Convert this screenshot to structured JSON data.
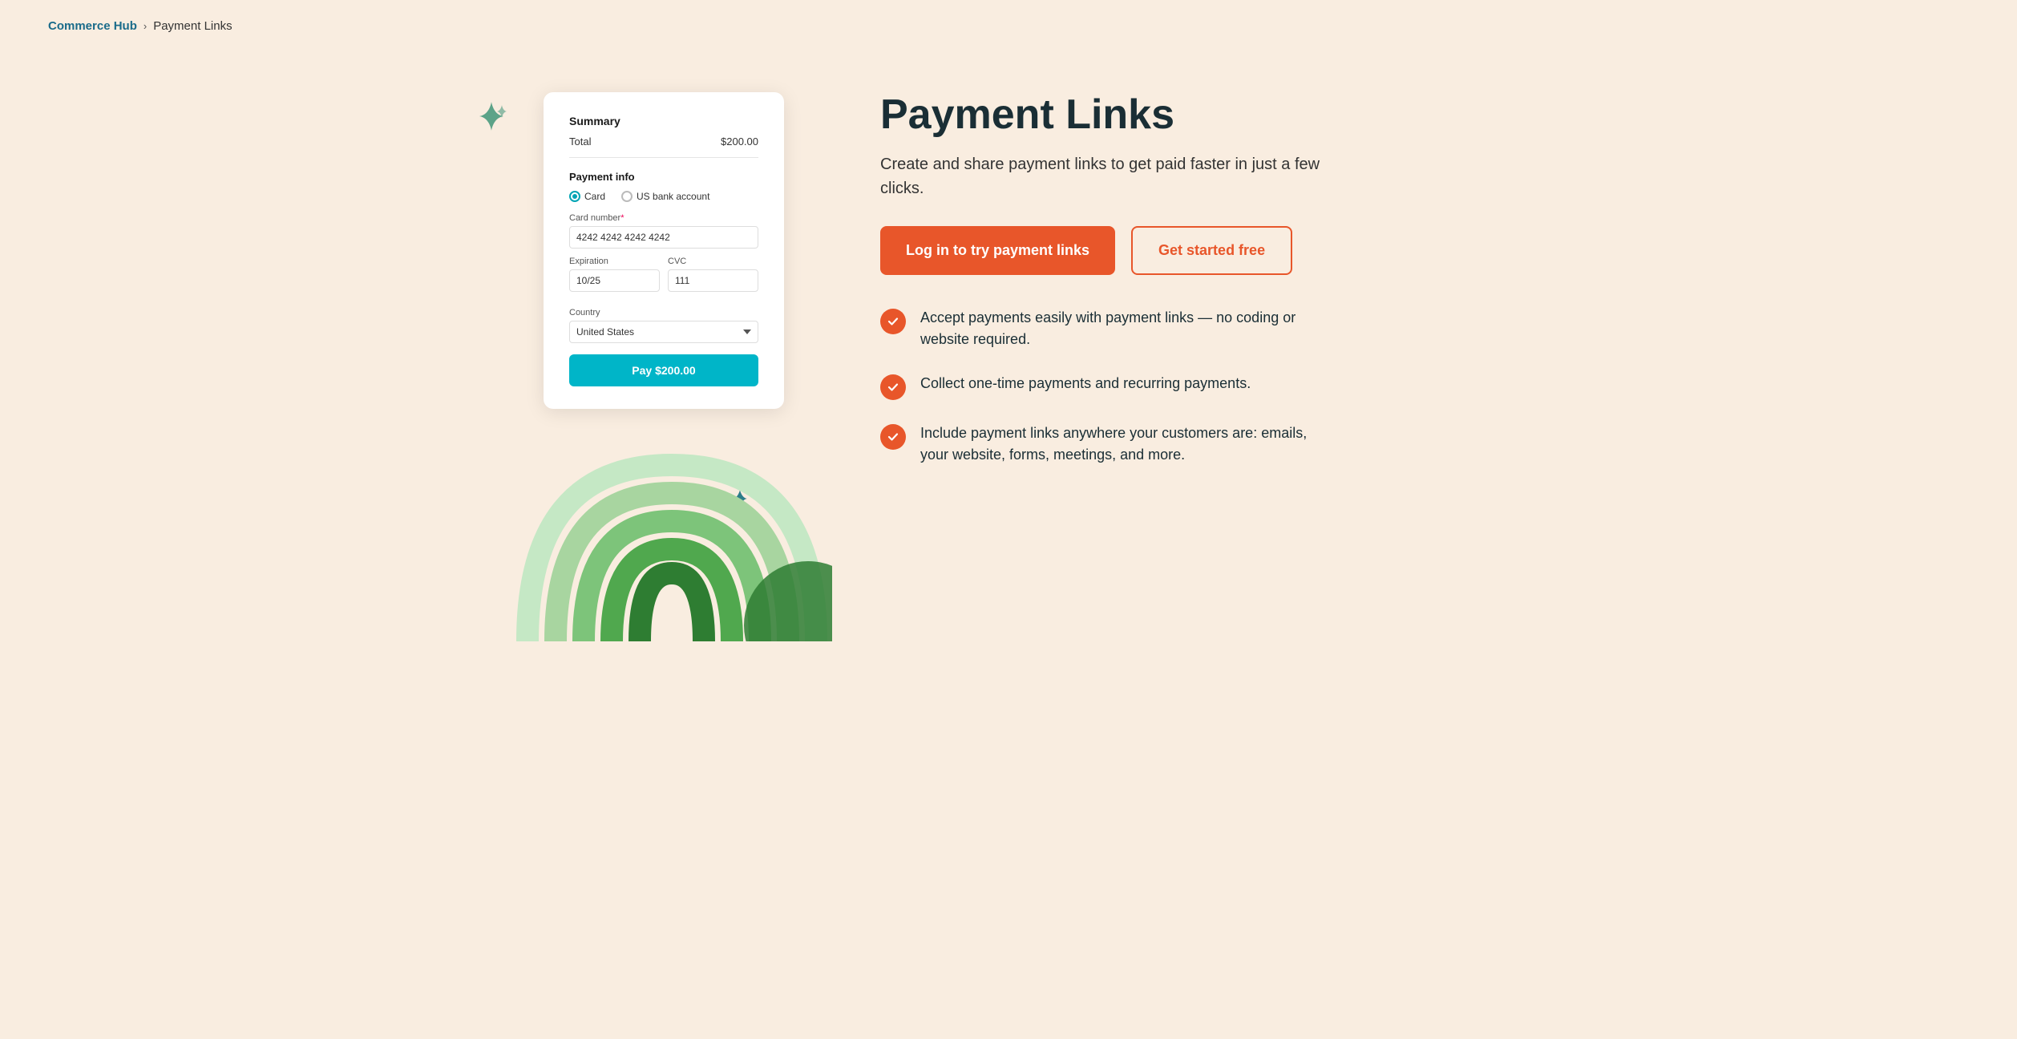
{
  "breadcrumb": {
    "commerce_hub": "Commerce Hub",
    "separator": ">",
    "current": "Payment Links"
  },
  "payment_card": {
    "summary_title": "Summary",
    "total_label": "Total",
    "total_value": "$200.00",
    "payment_info_title": "Payment info",
    "card_option": "Card",
    "bank_option": "US bank account",
    "card_number_label": "Card number",
    "card_number_required": "*",
    "card_number_value": "4242 4242 4242 4242",
    "expiration_label": "Expiration",
    "expiration_value": "10/25",
    "cvc_label": "CVC",
    "cvc_value": "111",
    "country_label": "Country",
    "country_value": "United States",
    "pay_button": "Pay $200.00"
  },
  "hero": {
    "title": "Payment Links",
    "subtitle": "Create and share payment links to get paid faster in just a few clicks.",
    "cta_primary": "Log in to try payment links",
    "cta_secondary": "Get started free"
  },
  "features": [
    {
      "text": "Accept payments easily with payment links — no coding or website required."
    },
    {
      "text": "Collect one-time payments and recurring payments."
    },
    {
      "text": "Include payment links anywhere your customers are: emails, your website, forms, meetings, and more."
    }
  ]
}
